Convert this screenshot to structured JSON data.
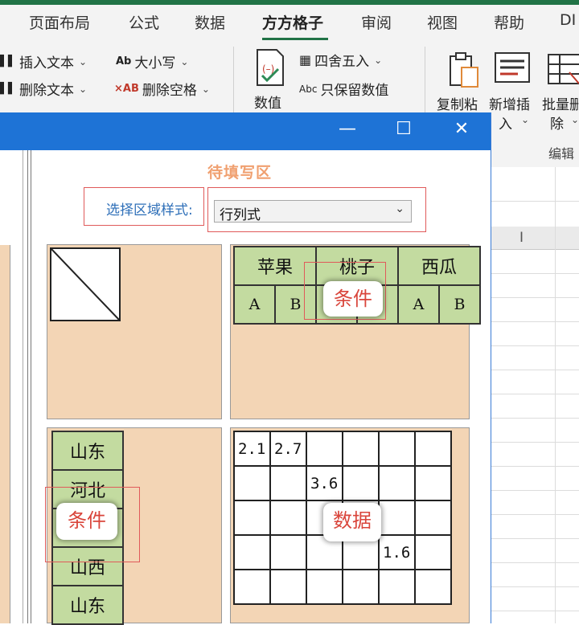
{
  "ribbon_tabs": [
    "页面布局",
    "公式",
    "数据",
    "方方格子",
    "审阅",
    "视图",
    "帮助",
    "DI"
  ],
  "active_tab": "方方格子",
  "ribbon": {
    "insert_text": "插入文本",
    "delete_text": "删除文本",
    "case": "大小写",
    "case_icon": "Ab",
    "delete_spaces": "删除空格",
    "delete_spaces_icon": "×AB",
    "value_btn": "数值",
    "round": "四舍五入",
    "keep_value": "只保留数值",
    "keep_value_icon": "Abc",
    "copy_paste": "复制粘",
    "new_insert_1": "新增插",
    "new_insert_2": "入",
    "batch_delete_1": "批量删",
    "batch_delete_2": "除",
    "group_edit": "编辑"
  },
  "grid": {
    "col_label": "I"
  },
  "dialog": {
    "minimize": "—",
    "maximize": "☐",
    "close": "✕",
    "pending_title": "待填写区",
    "select_label": "选择区域样式:",
    "select_value": "行列式",
    "header_groups": [
      "苹果",
      "桃子",
      "西瓜"
    ],
    "header_sub": [
      "A",
      "B",
      "A",
      "B",
      "A",
      "B"
    ],
    "row_labels": [
      "山东",
      "河北",
      "山西",
      "山西",
      "山东"
    ],
    "data_rows": [
      [
        "2.1",
        "2.7",
        "",
        "",
        "",
        ""
      ],
      [
        "",
        "",
        "3.6",
        "",
        "",
        ""
      ],
      [
        "",
        "",
        "",
        "",
        "",
        ""
      ],
      [
        "",
        "",
        "",
        "",
        "1.6",
        ""
      ],
      [
        "",
        "",
        "",
        "",
        "",
        ""
      ]
    ],
    "tag_condition_top": "条件",
    "tag_condition_left": "条件",
    "tag_data": "数据"
  },
  "colors": {
    "titlebar": "#1e73d6",
    "panel": "#f3d5b5",
    "header_green": "#c3dba0",
    "excel_green": "#217346",
    "tag_red": "#d9453b"
  }
}
